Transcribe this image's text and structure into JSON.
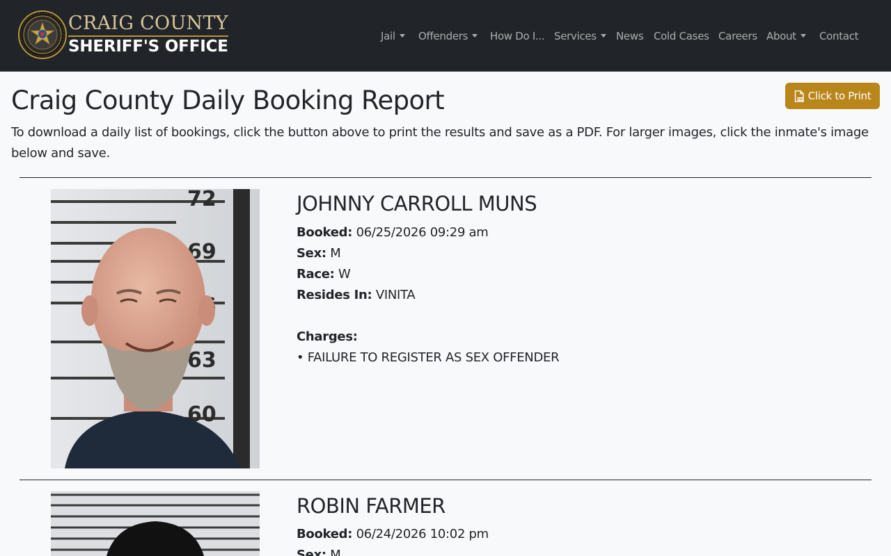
{
  "brand": {
    "line1": "CRAIG COUNTY",
    "line2": "SHERIFF'S OFFICE",
    "colors": {
      "gold": "#b8963f",
      "cream": "#d9c598",
      "navbar": "#212529"
    }
  },
  "nav": {
    "items": [
      {
        "label": "Jail",
        "dropdown": true
      },
      {
        "label": "Offenders",
        "dropdown": true
      },
      {
        "label": "How Do I...",
        "dropdown": false
      },
      {
        "label": "Services",
        "dropdown": true
      },
      {
        "label": "News",
        "dropdown": false
      },
      {
        "label": "Cold Cases",
        "dropdown": false
      },
      {
        "label": "Careers",
        "dropdown": false
      },
      {
        "label": "About",
        "dropdown": true
      },
      {
        "label": "Contact",
        "dropdown": false
      }
    ]
  },
  "page": {
    "title": "Craig County Daily Booking Report",
    "print_label": "Click to Print",
    "print_icon": "file-pdf-icon",
    "accent": "#b8861b",
    "intro": "To download a daily list of bookings, click the button above to print the results and save as a PDF. For larger images, click the inmate's image below and save."
  },
  "labels": {
    "booked": "Booked:",
    "sex": "Sex:",
    "race": "Race:",
    "resides": "Resides In:",
    "charges": "Charges:"
  },
  "inmates": [
    {
      "name": "JOHNNY CARROLL MUNS",
      "booked": "06/25/2026 09:29 am",
      "sex": "M",
      "race": "W",
      "resides": "VINITA",
      "charges": [
        "• FAILURE TO REGISTER AS SEX OFFENDER"
      ],
      "height_marks": [
        "72",
        "69",
        "66",
        "63",
        "60"
      ]
    },
    {
      "name": "ROBIN FARMER",
      "booked": "06/24/2026 10:02 pm",
      "sex": "M"
    }
  ]
}
